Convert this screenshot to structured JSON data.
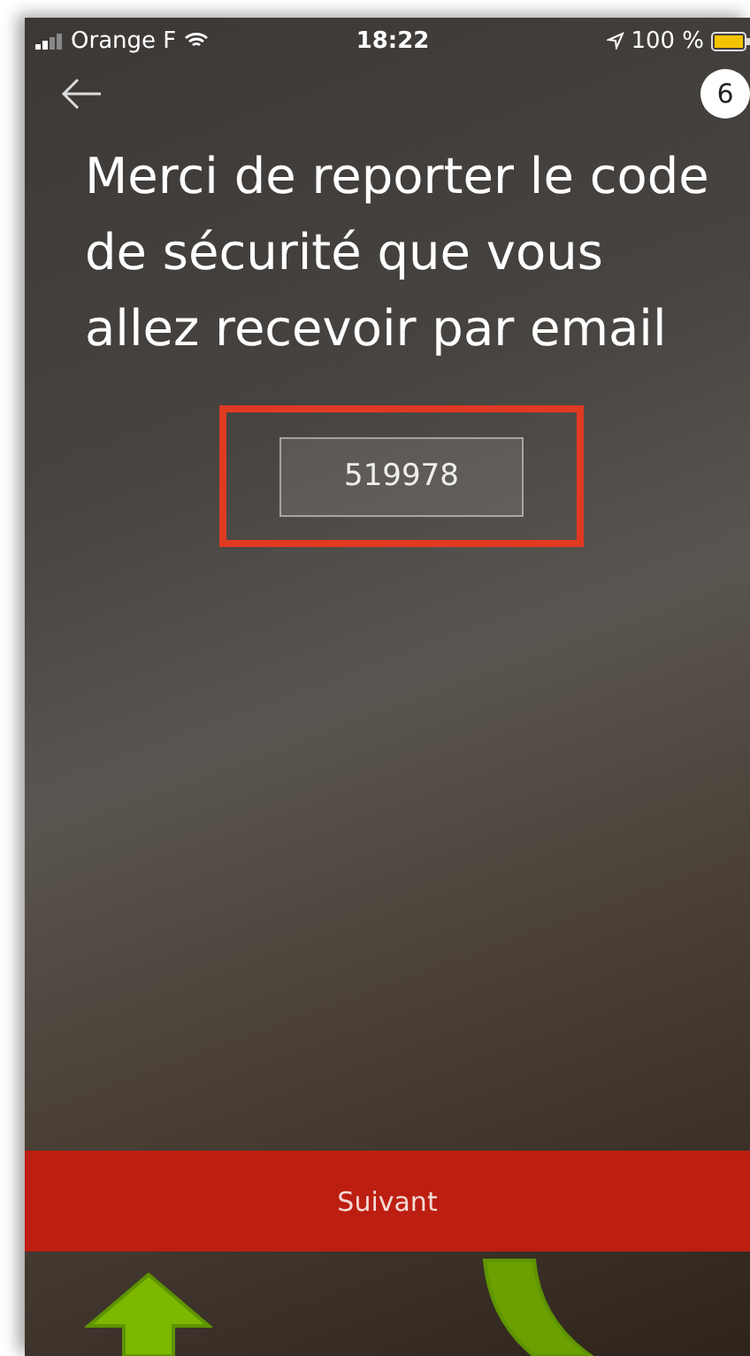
{
  "status_bar": {
    "carrier": "Orange F",
    "time": "18:22",
    "battery": "100 %"
  },
  "step_badge": "6",
  "title": "Merci de reporter le code de sécurité que vous allez recevoir par email",
  "code_field": {
    "value": "519978",
    "highlighted": true
  },
  "next_button": {
    "label": "Suivant"
  }
}
